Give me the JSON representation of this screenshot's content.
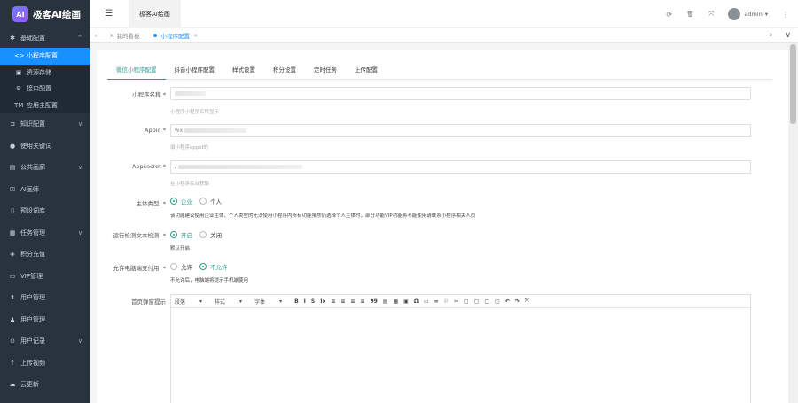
{
  "app": {
    "logo_text": "AI",
    "title": "极客AI绘画"
  },
  "sidebar": {
    "group": {
      "label": "基础配置",
      "arrow": "^"
    },
    "sub_items": [
      {
        "label": "小程序配置",
        "icon": "<>",
        "active": true
      },
      {
        "label": "资源存储",
        "icon": "▣",
        "active": false
      },
      {
        "label": "接口配置",
        "icon": "⚙",
        "active": false
      },
      {
        "label": "应用主配置",
        "icon": "TM",
        "active": false
      }
    ],
    "items": [
      {
        "label": "知识配置",
        "icon": "⊐",
        "arrow": "∨"
      },
      {
        "label": "使用关键词",
        "icon": "●",
        "arrow": ""
      },
      {
        "label": "公共画廊",
        "icon": "▤",
        "arrow": "∨"
      },
      {
        "label": "AI画师",
        "icon": "☑",
        "arrow": ""
      },
      {
        "label": "预设词库",
        "icon": "▯",
        "arrow": ""
      },
      {
        "label": "任务管理",
        "icon": "▦",
        "arrow": "∨"
      },
      {
        "label": "积分充值",
        "icon": "◈",
        "arrow": ""
      },
      {
        "label": "VIP管理",
        "icon": "▭",
        "arrow": ""
      },
      {
        "label": "用户管理",
        "icon": "⬆",
        "arrow": ""
      },
      {
        "label": "用户管理",
        "icon": "♟",
        "arrow": ""
      },
      {
        "label": "用户记录",
        "icon": "⊙",
        "arrow": "∨"
      },
      {
        "label": "上传视频",
        "icon": "↑",
        "arrow": ""
      },
      {
        "label": "云更新",
        "icon": "☁",
        "arrow": ""
      }
    ]
  },
  "navbar": {
    "hamburger": "☰",
    "top_tab": "极客AI绘画",
    "icons": {
      "refresh": "⟳",
      "trash": "🗑",
      "fullscreen": "⤧"
    },
    "user": "admin",
    "user_arrow": "▾",
    "more": "⋮"
  },
  "tagsbar": {
    "left_arrow": "‹",
    "tags": [
      {
        "label": "我的看板",
        "active": false
      },
      {
        "label": "小程序配置",
        "active": true
      }
    ],
    "close": "×",
    "right_arrow": "›",
    "down_arrow": "∨"
  },
  "tabs": [
    "微信小程序配置",
    "抖音小程序配置",
    "样式设置",
    "积分设置",
    "定时任务",
    "上传配置"
  ],
  "form": {
    "name_label": "小程序名称 *",
    "name_hint": "小程序小程序名称显示",
    "appid_label": "Appid *",
    "appid_value": "wx",
    "appid_hint": "填小程序appid的",
    "secret_label": "Appsecret *",
    "secret_value": "/",
    "secret_hint": "在小程序后台获取",
    "subject_label": "主体类型: *",
    "subject_options": [
      "企业",
      "个人"
    ],
    "subject_checked": 0,
    "subject_desc": "该功能建议使用企业主体，个人类型的无法使用小程序内所有功能虽然仍选择个人主体时，部分功能VIP功能将不能使用请联系小程序相关人员",
    "review_label": "运行检测文本检测: *",
    "review_options": [
      "开启",
      "关闭"
    ],
    "review_checked": 0,
    "review_desc": "默认开启",
    "payment_label": "允许电脑端支付用: *",
    "payment_options": [
      "允许",
      "不允许"
    ],
    "payment_checked": 1,
    "payment_desc": "不允许后，电脑端将提示手机端使用",
    "editor_label": "首页弹窗提示",
    "editor_toolbar": {
      "format_label": "段落",
      "style_label": "样式",
      "font_label": "字体",
      "buttons": [
        "B",
        "I",
        "S",
        "Ix",
        "≡",
        "≡",
        "≡",
        "≡",
        "99",
        "▤",
        "▦",
        "▣",
        "Ω",
        "▭",
        "∞",
        "⚐",
        "✂",
        "▢",
        "▢",
        "▢",
        "▢",
        "↶",
        "↷",
        "⤧"
      ]
    }
  },
  "colors": {
    "sidebar_bg": "#28333e",
    "active_blue": "#1890ff",
    "accent_teal": "#2a9d8f"
  }
}
